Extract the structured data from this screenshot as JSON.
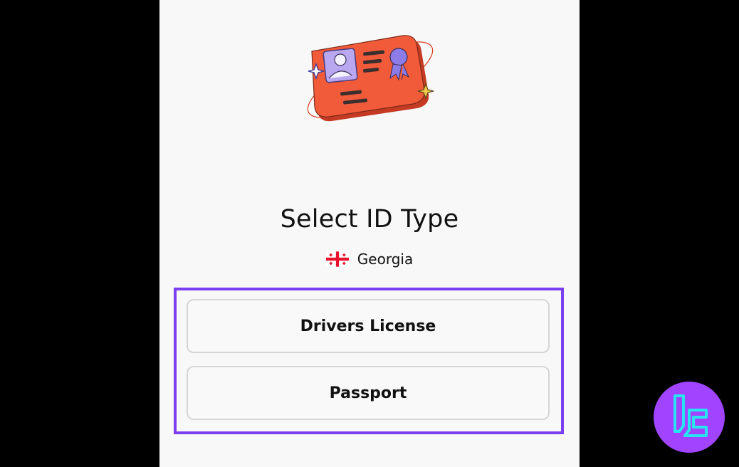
{
  "screen": {
    "title": "Select ID Type",
    "country": {
      "name": "Georgia",
      "flag_icon": "georgia-flag-icon"
    },
    "illustration_icon": "id-card-icon",
    "options": [
      {
        "label": "Drivers License"
      },
      {
        "label": "Passport"
      }
    ],
    "highlight_color": "#7b3ff2"
  },
  "watermark": {
    "icon": "brand-logo-icon",
    "color": "#a044ff"
  }
}
